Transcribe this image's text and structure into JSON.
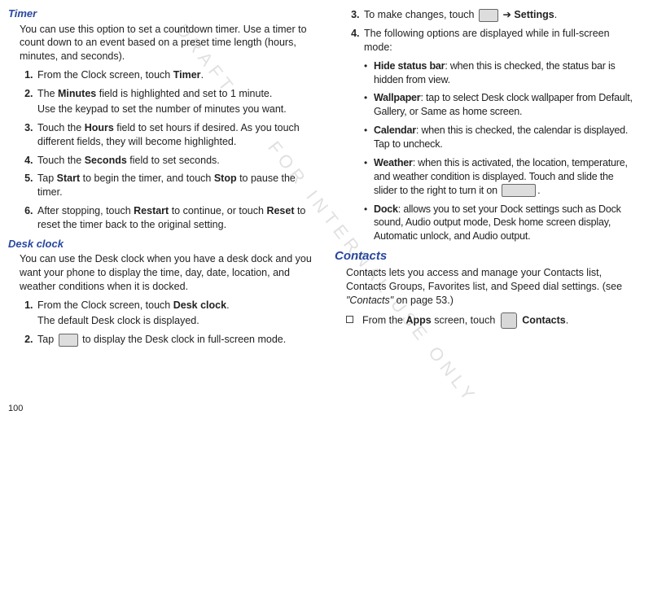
{
  "pageNumber": "100",
  "watermark": {
    "a": "DRAFT",
    "b": "FOR INTERNAL USE ONLY"
  },
  "left": {
    "timerTitle": "Timer",
    "timerIntro": "You can use this option to set a countdown timer. Use a timer to count down to an event based on a preset time length (hours, minutes, and seconds).",
    "timerSteps": {
      "s1a": "From the Clock screen, touch ",
      "s1b": "Timer",
      "s1c": ".",
      "s2a": "The ",
      "s2b": "Minutes",
      "s2c": " field is highlighted and set to 1 minute.",
      "s2sub": "Use the keypad to set the number of minutes you want.",
      "s3a": "Touch the ",
      "s3b": "Hours",
      "s3c": " field to set hours if desired. As you touch different fields, they will become highlighted.",
      "s4a": "Touch the ",
      "s4b": "Seconds",
      "s4c": " field to set seconds.",
      "s5a": "Tap ",
      "s5b": "Start",
      "s5c": " to begin the timer, and touch ",
      "s5d": "Stop",
      "s5e": " to pause the timer.",
      "s6a": "After stopping, touch ",
      "s6b": "Restart",
      "s6c": " to continue, or touch ",
      "s6d": "Reset",
      "s6e": " to reset the timer back to the original setting."
    },
    "deskTitle": "Desk clock",
    "deskIntro": "You can use the Desk clock when you have a desk dock and you want your phone to display the time, day, date, location, and weather conditions when it is docked.",
    "deskSteps": {
      "d1a": "From the Clock screen, touch ",
      "d1b": "Desk clock",
      "d1c": ".",
      "d1sub": "The default Desk clock is displayed.",
      "d2a": "Tap ",
      "d2b": " to display the Desk clock in full-screen mode."
    }
  },
  "right": {
    "contSteps": {
      "c3a": "To make changes, touch ",
      "c3b": " ➔ ",
      "c3c": "Settings",
      "c3d": ".",
      "c4": "The following options are displayed while in full-screen mode:"
    },
    "opts": {
      "hsbT": "Hide status bar",
      "hsbD": ": when this is checked, the status bar is hidden from view.",
      "wpT": "Wallpaper",
      "wpD": ": tap to select Desk clock wallpaper from Default, Gallery, or Same as home screen.",
      "calT": "Calendar",
      "calD": ": when this is checked, the calendar is displayed. Tap to uncheck.",
      "wthT": "Weather",
      "wthD1": ": when this is activated, the location, temperature, and weather condition is displayed. Touch and slide the slider to the right to turn it on ",
      "wthD2": ".",
      "dkT": "Dock",
      "dkD": ": allows you to set your Dock settings such as Dock sound, Audio output mode, Desk home screen display, Automatic unlock, and Audio output."
    },
    "contactsTitle": "Contacts",
    "contactsIntro1": "Contacts lets you access and manage your Contacts list, Contacts Groups, Favorites list, and Speed dial settings. (see ",
    "contactsIntroItalic": "\"Contacts\"",
    "contactsIntro2": " on page 53.)",
    "contactsStep": {
      "a": "From the ",
      "b": "Apps",
      "c": " screen, touch ",
      "d": "Contacts",
      "e": "."
    }
  }
}
